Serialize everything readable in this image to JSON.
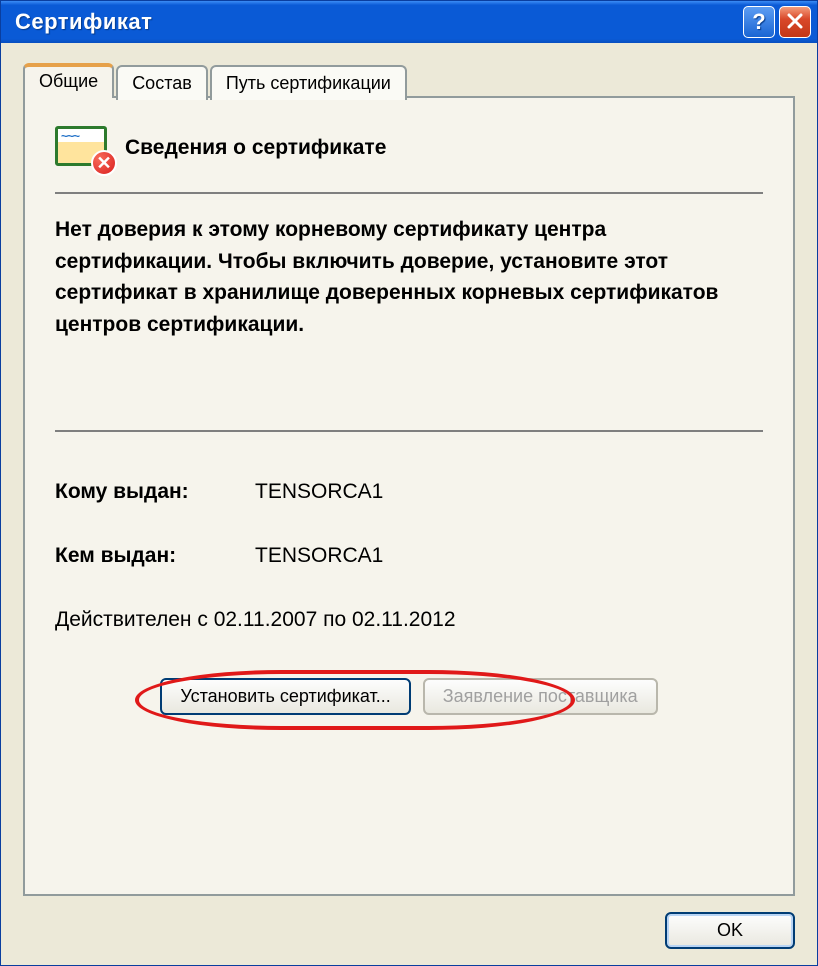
{
  "window": {
    "title": "Сертификат"
  },
  "tabs": {
    "general": "Общие",
    "details": "Состав",
    "path": "Путь сертификации"
  },
  "cert": {
    "heading": "Сведения о сертификате",
    "warning": "Нет доверия к этому корневому сертификату центра сертификации. Чтобы включить доверие, установите этот сертификат в хранилище доверенных корневых сертификатов центров сертификации.",
    "issued_to_label": "Кому выдан:",
    "issued_to_value": "TENSORCA1",
    "issued_by_label": "Кем выдан:",
    "issued_by_value": "TENSORCA1",
    "validity": "Действителен с 02.11.2007 по 02.11.2012"
  },
  "buttons": {
    "install": "Установить сертификат...",
    "issuer_statement": "Заявление поставщика",
    "ok": "OK"
  }
}
